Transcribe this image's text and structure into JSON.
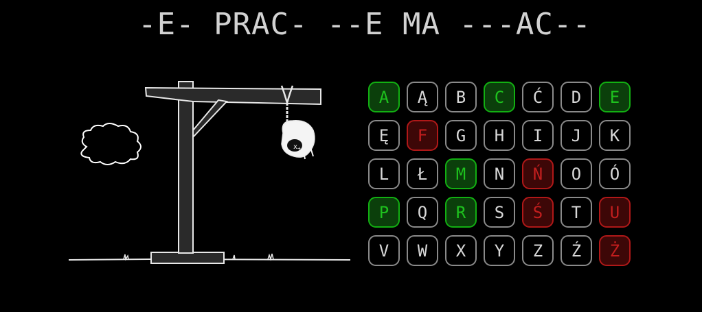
{
  "puzzle": {
    "display": "-E- PRAC- --E MA ---AC--"
  },
  "colors": {
    "correct": "#1ec21e",
    "wrong": "#c21e1e",
    "unused": "#d8d8d8",
    "background": "#000000"
  },
  "hangman": {
    "icons": [
      "gallows-icon",
      "cloud-icon",
      "hanged-head-icon",
      "grass-icon"
    ]
  },
  "keyboard": {
    "keys": [
      {
        "letter": "A",
        "state": "correct"
      },
      {
        "letter": "Ą",
        "state": "unused"
      },
      {
        "letter": "B",
        "state": "unused"
      },
      {
        "letter": "C",
        "state": "correct"
      },
      {
        "letter": "Ć",
        "state": "unused"
      },
      {
        "letter": "D",
        "state": "unused"
      },
      {
        "letter": "E",
        "state": "correct"
      },
      {
        "letter": "Ę",
        "state": "unused"
      },
      {
        "letter": "F",
        "state": "wrong"
      },
      {
        "letter": "G",
        "state": "unused"
      },
      {
        "letter": "H",
        "state": "unused"
      },
      {
        "letter": "I",
        "state": "unused"
      },
      {
        "letter": "J",
        "state": "unused"
      },
      {
        "letter": "K",
        "state": "unused"
      },
      {
        "letter": "L",
        "state": "unused"
      },
      {
        "letter": "Ł",
        "state": "unused"
      },
      {
        "letter": "M",
        "state": "correct"
      },
      {
        "letter": "N",
        "state": "unused"
      },
      {
        "letter": "Ń",
        "state": "wrong"
      },
      {
        "letter": "O",
        "state": "unused"
      },
      {
        "letter": "Ó",
        "state": "unused"
      },
      {
        "letter": "P",
        "state": "correct"
      },
      {
        "letter": "Q",
        "state": "unused"
      },
      {
        "letter": "R",
        "state": "correct"
      },
      {
        "letter": "S",
        "state": "unused"
      },
      {
        "letter": "Ś",
        "state": "wrong"
      },
      {
        "letter": "T",
        "state": "unused"
      },
      {
        "letter": "U",
        "state": "wrong"
      },
      {
        "letter": "V",
        "state": "unused"
      },
      {
        "letter": "W",
        "state": "unused"
      },
      {
        "letter": "X",
        "state": "unused"
      },
      {
        "letter": "Y",
        "state": "unused"
      },
      {
        "letter": "Z",
        "state": "unused"
      },
      {
        "letter": "Ź",
        "state": "unused"
      },
      {
        "letter": "Ż",
        "state": "wrong"
      }
    ]
  }
}
